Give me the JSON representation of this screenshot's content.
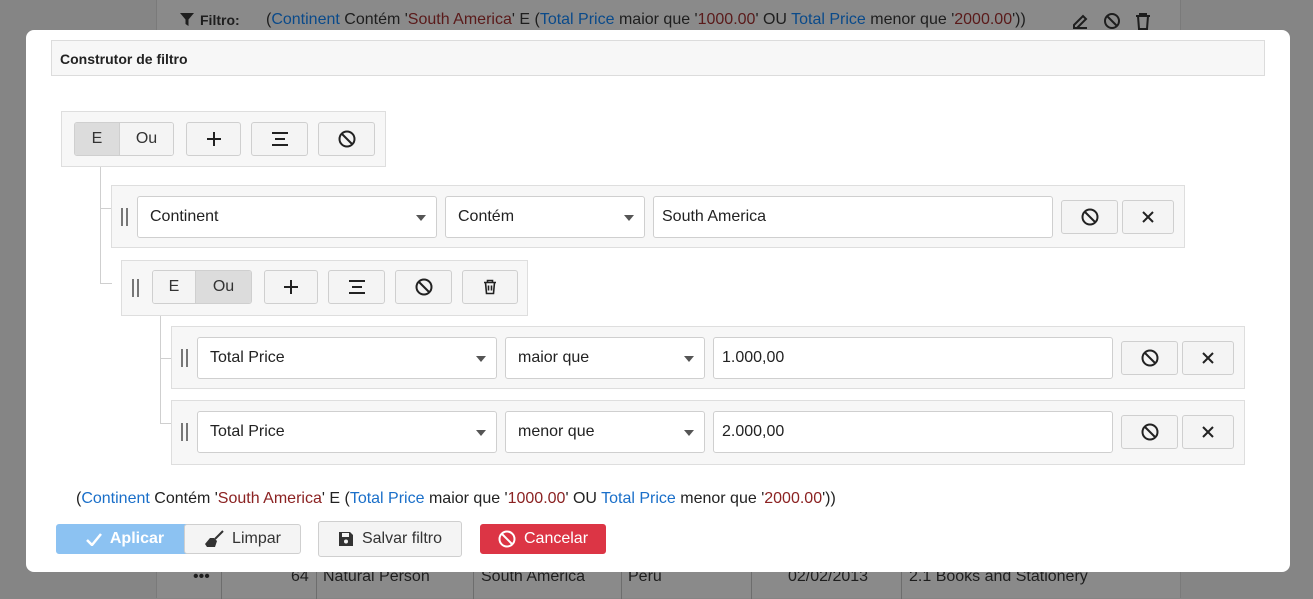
{
  "background": {
    "filter_label": "Filtro:",
    "filter_expression": [
      {
        "t": "(",
        "k": "plain"
      },
      {
        "t": "Continent",
        "k": "field"
      },
      {
        "t": " Contém '",
        "k": "plain"
      },
      {
        "t": "South America",
        "k": "value"
      },
      {
        "t": "' E (",
        "k": "plain"
      },
      {
        "t": "Total Price",
        "k": "field"
      },
      {
        "t": " maior que '",
        "k": "plain"
      },
      {
        "t": "1000.00",
        "k": "value"
      },
      {
        "t": "' OU ",
        "k": "plain"
      },
      {
        "t": "Total Price",
        "k": "field"
      },
      {
        "t": " menor que '",
        "k": "plain"
      },
      {
        "t": "2000.00",
        "k": "value"
      },
      {
        "t": "'))",
        "k": "plain"
      }
    ],
    "row": {
      "menu": "•••",
      "id": "64",
      "type": "Natural Person",
      "continent": "South America",
      "country": "Peru",
      "date": "02/02/2013",
      "category": "2.1 Books and Stationery"
    }
  },
  "modal": {
    "title": "Construtor de filtro",
    "root_group": {
      "and_label": "E",
      "or_label": "Ou",
      "active": "and"
    },
    "rule1": {
      "field": "Continent",
      "operator": "Contém",
      "value": "South America"
    },
    "sub_group": {
      "and_label": "E",
      "or_label": "Ou",
      "active": "or",
      "rule1": {
        "field": "Total Price",
        "operator": "maior que",
        "value": "1.000,00"
      },
      "rule2": {
        "field": "Total Price",
        "operator": "menor que",
        "value": "2.000,00"
      }
    },
    "summary": [
      {
        "t": "(",
        "k": "plain"
      },
      {
        "t": "Continent",
        "k": "field"
      },
      {
        "t": " Contém '",
        "k": "plain"
      },
      {
        "t": "South America",
        "k": "value"
      },
      {
        "t": "' E (",
        "k": "plain"
      },
      {
        "t": "Total Price",
        "k": "field"
      },
      {
        "t": " maior que '",
        "k": "plain"
      },
      {
        "t": "1000.00",
        "k": "value"
      },
      {
        "t": "' OU ",
        "k": "plain"
      },
      {
        "t": "Total Price",
        "k": "field"
      },
      {
        "t": " menor que '",
        "k": "plain"
      },
      {
        "t": "2000.00",
        "k": "value"
      },
      {
        "t": "'))",
        "k": "plain"
      }
    ],
    "footer": {
      "apply": "Aplicar",
      "clear": "Limpar",
      "save": "Salvar filtro",
      "cancel": "Cancelar"
    }
  },
  "colors": {
    "field": "#1a6fc9",
    "value": "#8b2222",
    "apply": "#8cc2f2",
    "cancel": "#dc3545"
  }
}
